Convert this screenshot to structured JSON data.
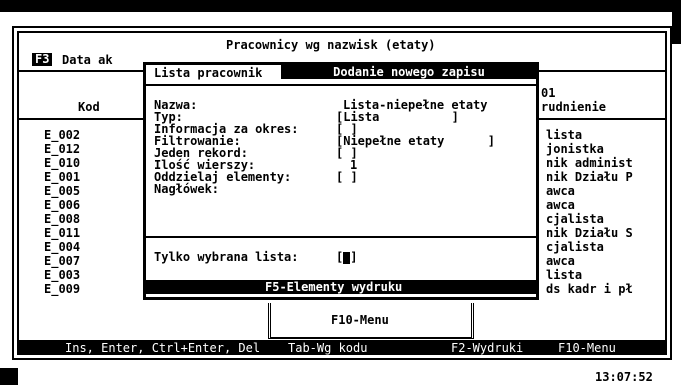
{
  "screen_title": "Pracownicy wg nazwisk (etaty)",
  "f3_key": "F3",
  "f3_label": "Data ak",
  "col_kod": "Kod",
  "col_right_header_top": "01",
  "col_right_header": "rudnienie",
  "rows": [
    {
      "kod": "E_002",
      "right": "lista"
    },
    {
      "kod": "E_012",
      "right": "jonistka"
    },
    {
      "kod": "E_010",
      "right": "nik administ"
    },
    {
      "kod": "E_001",
      "right": "nik Działu P"
    },
    {
      "kod": "E_005",
      "right": "awca"
    },
    {
      "kod": "E_006",
      "right": "awca"
    },
    {
      "kod": "E_008",
      "right": "cjalista"
    },
    {
      "kod": "E_011",
      "right": "nik Działu S"
    },
    {
      "kod": "E_004",
      "right": "cjalista"
    },
    {
      "kod": "E_007",
      "right": "awca"
    },
    {
      "kod": "E_003",
      "right": "lista"
    },
    {
      "kod": "E_009",
      "right": "ds kadr i pł"
    }
  ],
  "dialog": {
    "tab_left": "Lista pracownik",
    "title": "Dodanie nowego zapisu",
    "fields": {
      "nazwa_label": "Nazwa:",
      "nazwa_value": "Lista-niepełne etaty",
      "typ_label": "Typ:",
      "typ_value": "[Lista          ]",
      "informacja_label": "Informacja za okres:",
      "informacja_value": "[ ]",
      "filtrowanie_label": "Filtrowanie:",
      "filtrowanie_value": "[Niepełne etaty      ]",
      "jeden_rekord_label": "Jeden rekord:",
      "jeden_rekord_value": "[ ]",
      "ilosc_wierszy_label": "Ilość wierszy:",
      "ilosc_wierszy_value": "1",
      "oddzielaj_label": "Oddzielaj elementy:",
      "oddzielaj_value": "[ ]",
      "naglowek_label": "Nagłówek:"
    },
    "tylko_label": "Tylko wybrana lista:",
    "tylko_open": "[",
    "tylko_close": "]",
    "elements_button": "F5-Elementy wydruku"
  },
  "f10_menu": "F10-Menu",
  "status": {
    "left": "Ins, Enter, Ctrl+Enter, Del",
    "mid": "Tab-Wg kodu",
    "f2": "F2-Wydruki",
    "f10": "F10-Menu"
  },
  "clock": "13:07:52"
}
